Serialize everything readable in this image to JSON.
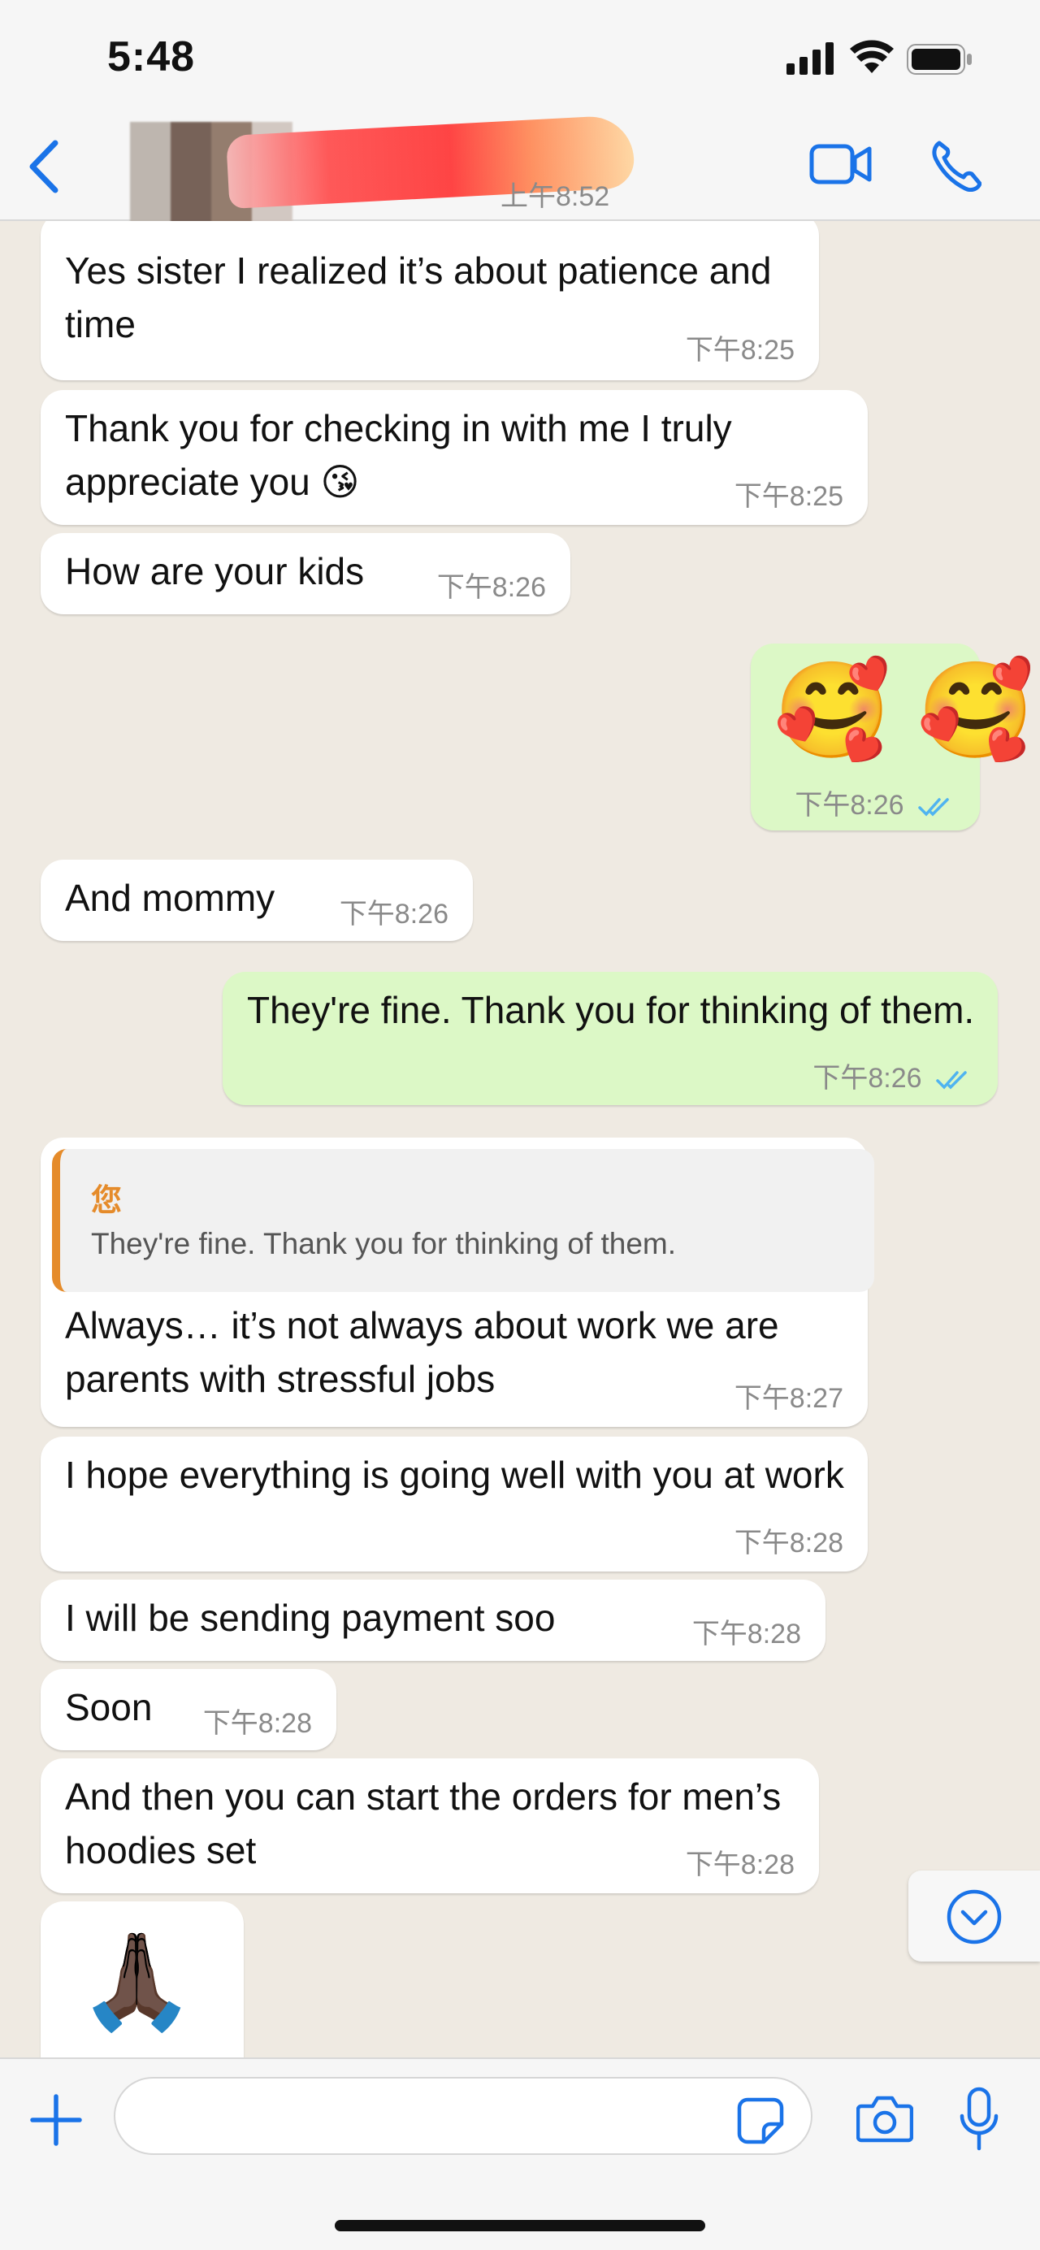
{
  "status_bar": {
    "time": "5:48"
  },
  "header": {
    "last_seen": "上午8:52"
  },
  "messages": [
    {
      "dir": "in",
      "text": "Yes sister I realized it’s about patience and time",
      "time": "下午8:25"
    },
    {
      "dir": "in",
      "text": "Thank you for checking in with me I truly appreciate you 😘",
      "time": "下午8:25"
    },
    {
      "dir": "in",
      "text": "How are your kids",
      "time": "下午8:26"
    },
    {
      "dir": "out",
      "text": "🥰 🥰",
      "time": "下午8:26"
    },
    {
      "dir": "in",
      "text": "And mommy",
      "time": "下午8:26"
    },
    {
      "dir": "out",
      "text": "They're fine. Thank you for thinking of them.",
      "time": "下午8:26"
    },
    {
      "dir": "in",
      "quote_author": "您",
      "quote_text": "They're fine. Thank you for thinking of them.",
      "text": "Always… it’s not always about work we are parents with stressful jobs",
      "time": "下午8:27"
    },
    {
      "dir": "in",
      "text": "I hope everything is going well with you at work",
      "time": "下午8:28"
    },
    {
      "dir": "in",
      "text": "I will be sending payment soo",
      "time": "下午8:28"
    },
    {
      "dir": "in",
      "text": "Soon",
      "time": "下午8:28"
    },
    {
      "dir": "in",
      "text": "And then you can start the orders for men’s hoodies set",
      "time": "下午8:28"
    },
    {
      "dir": "in",
      "text": "🙏🏿"
    }
  ],
  "icons": [
    "signal-icon",
    "wifi-icon",
    "battery-icon",
    "back-chevron-icon",
    "video-camera-icon",
    "phone-icon",
    "double-check-icon",
    "scroll-down-icon",
    "plus-icon",
    "sticker-icon",
    "camera-icon",
    "mic-icon"
  ],
  "colors": {
    "accent": "#1a73e8",
    "out_bubble": "#dcf8c6",
    "in_bubble": "#ffffff",
    "read_ticks": "#4fb3f0",
    "quote_bar": "#e58b2a"
  }
}
